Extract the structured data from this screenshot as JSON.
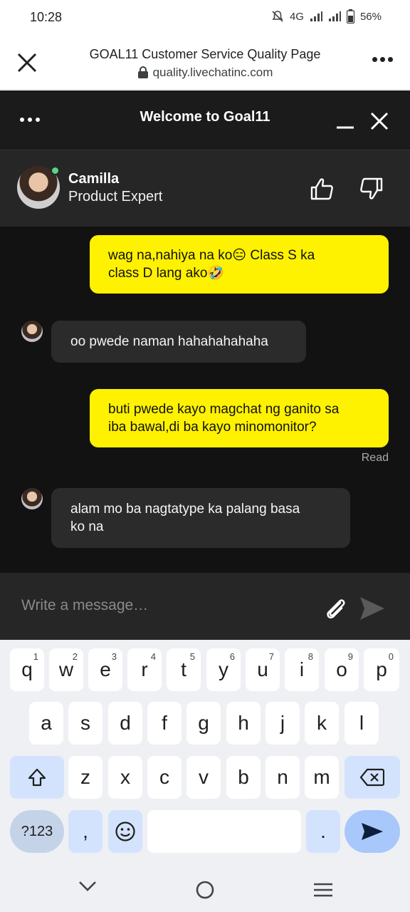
{
  "status_bar": {
    "time": "10:28",
    "network": "4G",
    "battery": "56%"
  },
  "browser": {
    "title": "GOAL11 Customer Service Quality Page",
    "url": "quality.livechatinc.com"
  },
  "chat": {
    "title": "Welcome to Goal11",
    "agent": {
      "name": "Camilla",
      "role": "Product Expert"
    },
    "messages": [
      {
        "from": "user",
        "text_line1": "wag na,nahiya na ko😑 Class S ka",
        "text_line2": "class D lang ako🤣"
      },
      {
        "from": "agent",
        "text": "oo pwede naman hahahahahaha"
      },
      {
        "from": "user",
        "text_line1": "buti pwede kayo magchat ng ganito sa",
        "text_line2": "iba bawal,di ba kayo minomonitor?"
      },
      {
        "from": "agent",
        "text_line1": "alam mo ba nagtatype ka palang basa",
        "text_line2": "ko na"
      }
    ],
    "read_label": "Read",
    "composer_placeholder": "Write a message…"
  },
  "keyboard": {
    "row1": [
      {
        "key": "q",
        "hint": "1"
      },
      {
        "key": "w",
        "hint": "2"
      },
      {
        "key": "e",
        "hint": "3"
      },
      {
        "key": "r",
        "hint": "4"
      },
      {
        "key": "t",
        "hint": "5"
      },
      {
        "key": "y",
        "hint": "6"
      },
      {
        "key": "u",
        "hint": "7"
      },
      {
        "key": "i",
        "hint": "8"
      },
      {
        "key": "o",
        "hint": "9"
      },
      {
        "key": "p",
        "hint": "0"
      }
    ],
    "row2": [
      "a",
      "s",
      "d",
      "f",
      "g",
      "h",
      "j",
      "k",
      "l"
    ],
    "row3": [
      "z",
      "x",
      "c",
      "v",
      "b",
      "n",
      "m"
    ],
    "symbols_label": "?123",
    "comma": ",",
    "period": "."
  },
  "colors": {
    "user_bubble": "#fff200",
    "agent_bubble": "#2b2b2b",
    "online": "#5cd28a"
  }
}
